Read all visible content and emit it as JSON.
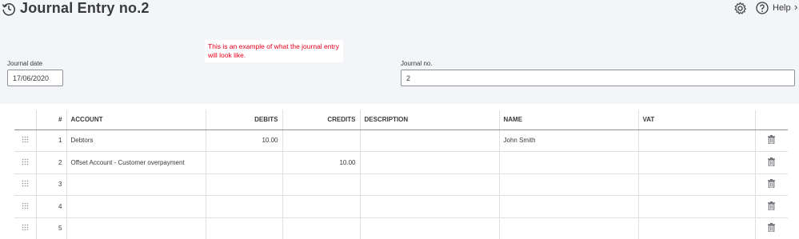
{
  "header": {
    "title": "Journal Entry no.2",
    "help_label": "Help",
    "close_label": "›"
  },
  "note": {
    "text": "This is an example of what the journal entry will look like."
  },
  "form": {
    "journal_date_label": "Journal date",
    "journal_date_value": "17/06/2020",
    "journal_no_label": "Journal no.",
    "journal_no_value": "2"
  },
  "table": {
    "columns": {
      "num": "#",
      "account": "ACCOUNT",
      "debits": "DEBITS",
      "credits": "CREDITS",
      "description": "DESCRIPTION",
      "name": "NAME",
      "vat": "VAT"
    },
    "rows": [
      {
        "num": "1",
        "account": "Debtors",
        "debits": "10.00",
        "credits": "",
        "description": "",
        "name": "John Smith",
        "vat": ""
      },
      {
        "num": "2",
        "account": "Offset Account - Customer overpayment",
        "debits": "",
        "credits": "10.00",
        "description": "",
        "name": "",
        "vat": ""
      },
      {
        "num": "3",
        "account": "",
        "debits": "",
        "credits": "",
        "description": "",
        "name": "",
        "vat": ""
      },
      {
        "num": "4",
        "account": "",
        "debits": "",
        "credits": "",
        "description": "",
        "name": "",
        "vat": ""
      },
      {
        "num": "5",
        "account": "",
        "debits": "",
        "credits": "",
        "description": "",
        "name": "",
        "vat": ""
      }
    ]
  },
  "icons": {
    "history": "history-clock-icon",
    "settings": "gear-icon",
    "help": "help-circle-icon",
    "close": "close-icon",
    "drag": "drag-handle-icon",
    "delete": "trash-icon"
  },
  "colors": {
    "header_bg": "#f4f5f8",
    "note_text": "#e8001c",
    "text": "#393a3d",
    "border": "#dcdfe4"
  }
}
